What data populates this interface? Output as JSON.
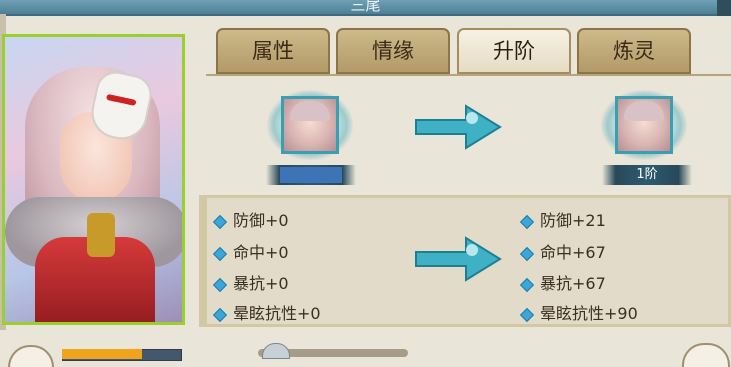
{
  "window": {
    "title": "三尾"
  },
  "tabs": [
    {
      "label": "属性",
      "active": false
    },
    {
      "label": "情缘",
      "active": false
    },
    {
      "label": "升阶",
      "active": true
    },
    {
      "label": "炼灵",
      "active": false
    }
  ],
  "upgrade": {
    "current_level_label": "",
    "next_level_label": "1阶"
  },
  "stats": {
    "current": [
      {
        "label": "防御+0"
      },
      {
        "label": "命中+0"
      },
      {
        "label": "暴抗+0"
      },
      {
        "label": "晕眩抗性+0"
      }
    ],
    "next": [
      {
        "label": "防御+21"
      },
      {
        "label": "命中+67"
      },
      {
        "label": "暴抗+67"
      },
      {
        "label": "晕眩抗性+90"
      }
    ]
  },
  "colors": {
    "tab_border": "#8c7449",
    "portrait_frame": "#9bcf2d",
    "stat_bullet": "#39a7d8",
    "arrow": "#3fb1c5"
  },
  "icons": {
    "arrow": "right-arrow-icon",
    "bullet": "diamond-icon"
  }
}
